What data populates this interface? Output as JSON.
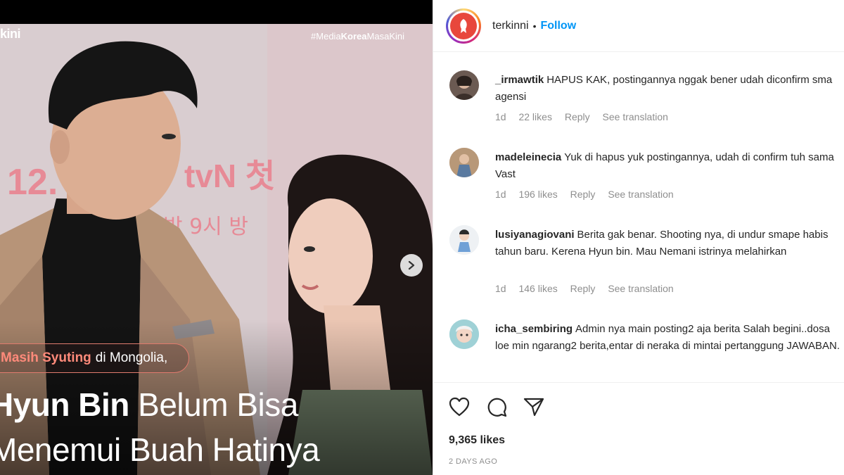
{
  "media": {
    "brand_fragment": "kini",
    "hashtag_prefix": "#Media",
    "hashtag_bold": "Korea",
    "hashtag_suffix": "MasaKini",
    "backdrop_text_date": "12.",
    "backdrop_text_tvn": "tvN 첫",
    "backdrop_text_time": "밤 9시 방",
    "subtitle_emphasis": "Masih Syuting",
    "subtitle_rest": "di Mongolia,",
    "headline_name": "Hyun Bin",
    "headline_rest": "Belum Bisa",
    "headline_line2": "Menemui Buah Hatinya",
    "next_icon": "chevron-right-icon"
  },
  "post": {
    "username": "terkinni",
    "dot": "•",
    "follow_label": "Follow"
  },
  "comments": [
    {
      "user": "_irmawtik",
      "text": "HAPUS KAK, postingannya nggak bener udah diconfirm sma agensi",
      "age": "1d",
      "likes": "22 likes",
      "reply": "Reply",
      "translate": "See translation"
    },
    {
      "user": "madeleinecia",
      "text": "Yuk di hapus yuk postingannya, udah di confirm tuh sama Vast",
      "age": "1d",
      "likes": "196 likes",
      "reply": "Reply",
      "translate": "See translation"
    },
    {
      "user": "lusiyanagiovani",
      "text": "Berita gak benar. Shooting nya, di undur smape habis tahun baru. Kerena Hyun bin. Mau Nemani istrinya melahirkan",
      "age": "1d",
      "likes": "146 likes",
      "reply": "Reply",
      "translate": "See translation"
    },
    {
      "user": "icha_sembiring",
      "text": "Admin nya main posting2 aja berita Salah begini..dosa loe min ngarang2 berita,entar di neraka di mintai pertanggung JAWABAN.",
      "age": "",
      "likes": "",
      "reply": "",
      "translate": ""
    }
  ],
  "actions": {
    "like_icon": "heart-icon",
    "comment_icon": "comment-icon",
    "share_icon": "share-icon",
    "likes_count": "9,365 likes",
    "posted_ago": "2 DAYS AGO"
  }
}
